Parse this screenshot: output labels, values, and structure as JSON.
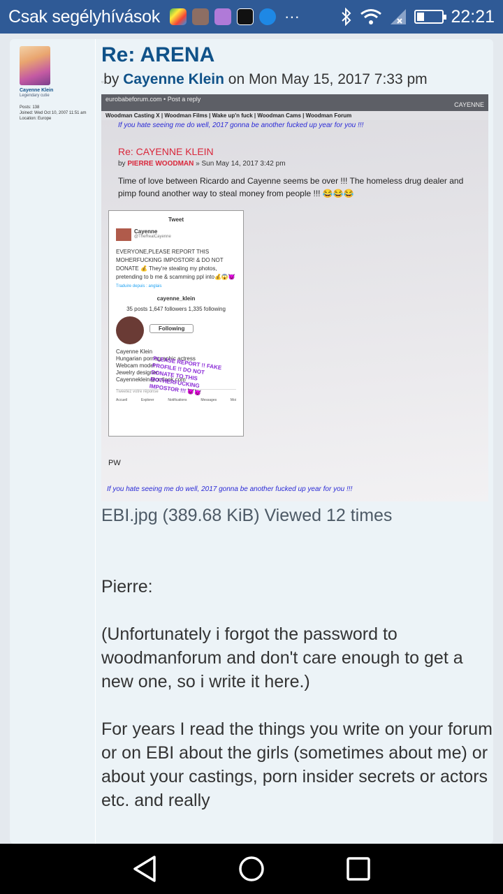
{
  "status_bar": {
    "carrier": "Csak segélyhívások",
    "time": "22:21",
    "battery_level": 0.3,
    "icons": [
      "play-games-icon",
      "news-icon",
      "gallery-icon",
      "upwork-icon",
      "messenger-icon",
      "more-dots-icon",
      "bluetooth-icon",
      "wifi-icon",
      "signal-icon",
      "battery-icon"
    ],
    "more_dots": "···"
  },
  "profile": {
    "name": "Cayenne Klein",
    "rank": "Legendary cutie",
    "posts": "Posts: 138",
    "joined": "Joined: Wed Oct 10, 2007 11:51 am",
    "location": "Location: Europe"
  },
  "post": {
    "title": "Re: ARENA",
    "by": "by",
    "author": "Cayenne Klein",
    "date": "on Mon May 15, 2017 7:33 pm"
  },
  "attachment": {
    "screenshot": {
      "top_bar": "eurobabeforum.com • Post a reply",
      "top_right": "CAYENNE",
      "nav": "Woodman Casting X | Woodman Films | Wake up'n fuck | Woodman Cams | Woodman Forum",
      "banner": "If you hate seeing me do well, 2017 gonna be another fucked up year for you !!!",
      "post_title": "Re: CAYENNE KLEIN",
      "post_by": "by",
      "post_author": "PIERRE WOODMAN",
      "post_date": "» Sun May 14, 2017 3:42 pm",
      "post_text": "Time of love between Ricardo and Cayenne seems be over !!! The homeless drug dealer and pimp found another way to steal money from people !!! 😂😂😂",
      "tweet": {
        "header": "Tweet",
        "user": "Cayenne",
        "handle_small": "@TheRealCayenne",
        "text": "EVERYONE,PLEASE REPORT THIS MOHERFUCKING IMPOSTOR! & DO NOT DONATE 💰 They're stealing my photos, pretending to b me & scamming ppl into💰😱😈",
        "translate": "Traduire depuis : anglais",
        "profile_handle": "cayenne_klein",
        "stats": "35 posts  1,647 followers  1,335 following",
        "following": "Following",
        "bio": "Cayenne Klein\nHungarian pornographic actress\nWebcam model\nJewelry designer\nCayenneklein@outlook.com",
        "warning": "PLEASE REPORT !! FAKE PROFILE !! DO NOT DONATE TO THIS MOTHERFUCKING IMPOSTOR !!! 😈😈",
        "reply_placeholder": "Tweetez votre réponse",
        "tabs": [
          "Accueil",
          "Explorer",
          "Notifications",
          "Messages",
          "Moi"
        ]
      },
      "pw": "PW",
      "bottom_banner": "If you hate seeing me do well, 2017 gonna be another fucked up year for you !!!"
    },
    "caption": "EBI.jpg (389.68 KiB) Viewed 12 times"
  },
  "content": {
    "p1": "Pierre:",
    "p2": "(Unfortunately i forgot the password to woodmanforum and don't care enough to get a new one, so i write it here.)",
    "p3": "For years I read the things you write on your forum or on EBI about the girls (sometimes about me) or about your castings, porn insider secrets or actors etc. and really"
  },
  "nav_bar": {
    "buttons": [
      "back-icon",
      "home-icon",
      "recents-icon"
    ]
  }
}
